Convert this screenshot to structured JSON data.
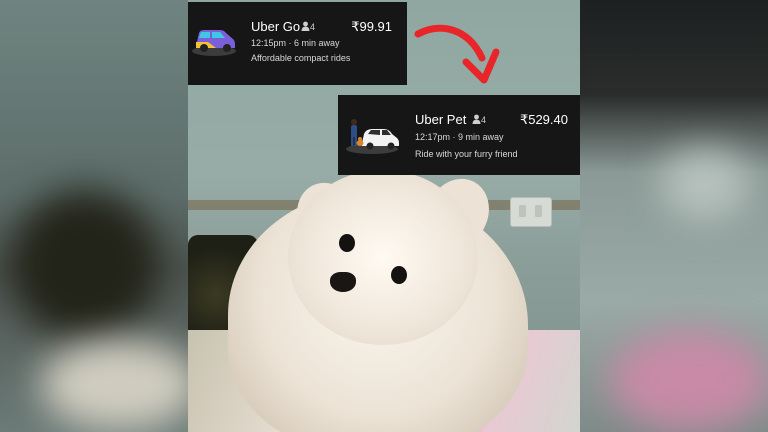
{
  "rides": [
    {
      "name": "Uber Go",
      "seats": "4",
      "price": "₹99.91",
      "eta": "12:15pm · 6 min away",
      "description": "Affordable compact rides",
      "icon": "car-icon"
    },
    {
      "name": "Uber Pet",
      "seats": "4",
      "price": "₹529.40",
      "eta": "12:17pm · 9 min away",
      "description": "Ride with your furry friend",
      "icon": "pet-car-icon"
    }
  ],
  "colors": {
    "card_bg": "#161616",
    "arrow": "#e8262a"
  },
  "icons": [
    "person-icon",
    "car-icon",
    "pet-car-icon",
    "arrow-icon"
  ]
}
